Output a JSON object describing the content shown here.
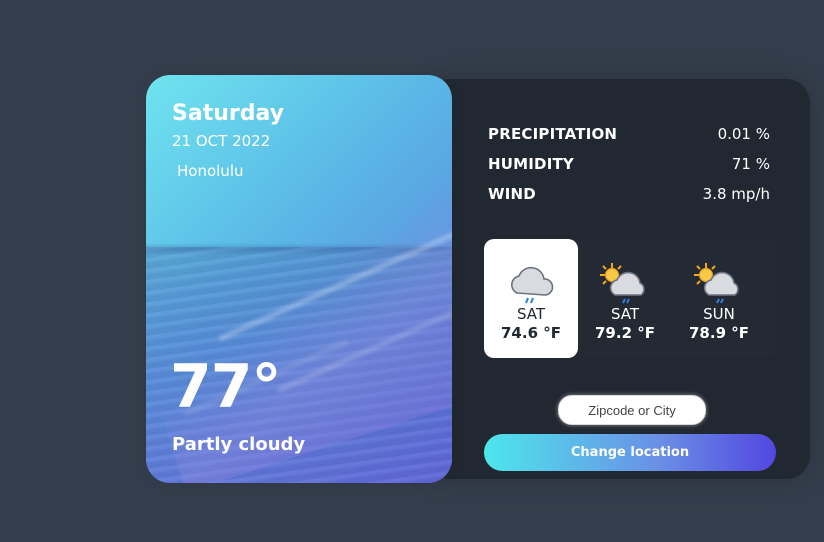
{
  "weather_side": {
    "day": "Saturday",
    "date": "21 OCT 2022",
    "location": "Honolulu",
    "temperature": "77°",
    "description": "Partly cloudy"
  },
  "stats": [
    {
      "title": "PRECIPITATION",
      "value": "0.01 %"
    },
    {
      "title": "HUMIDITY",
      "value": "71 %"
    },
    {
      "title": "WIND",
      "value": "3.8 mp/h"
    }
  ],
  "week": [
    {
      "day": "SAT",
      "temp": "74.6 °F",
      "icon": "cloud-rain-icon",
      "active": true
    },
    {
      "day": "SAT",
      "temp": "79.2 °F",
      "icon": "partly-cloudy-rain-icon",
      "active": false
    },
    {
      "day": "SUN",
      "temp": "78.9 °F",
      "icon": "partly-cloudy-rain-icon",
      "active": false
    }
  ],
  "location_form": {
    "placeholder": "Zipcode or City",
    "button_label": "Change location"
  },
  "colors": {
    "background": "#343d4b",
    "panel": "#222831",
    "accent_start": "#4ee6ec",
    "accent_end": "#5247e0"
  }
}
